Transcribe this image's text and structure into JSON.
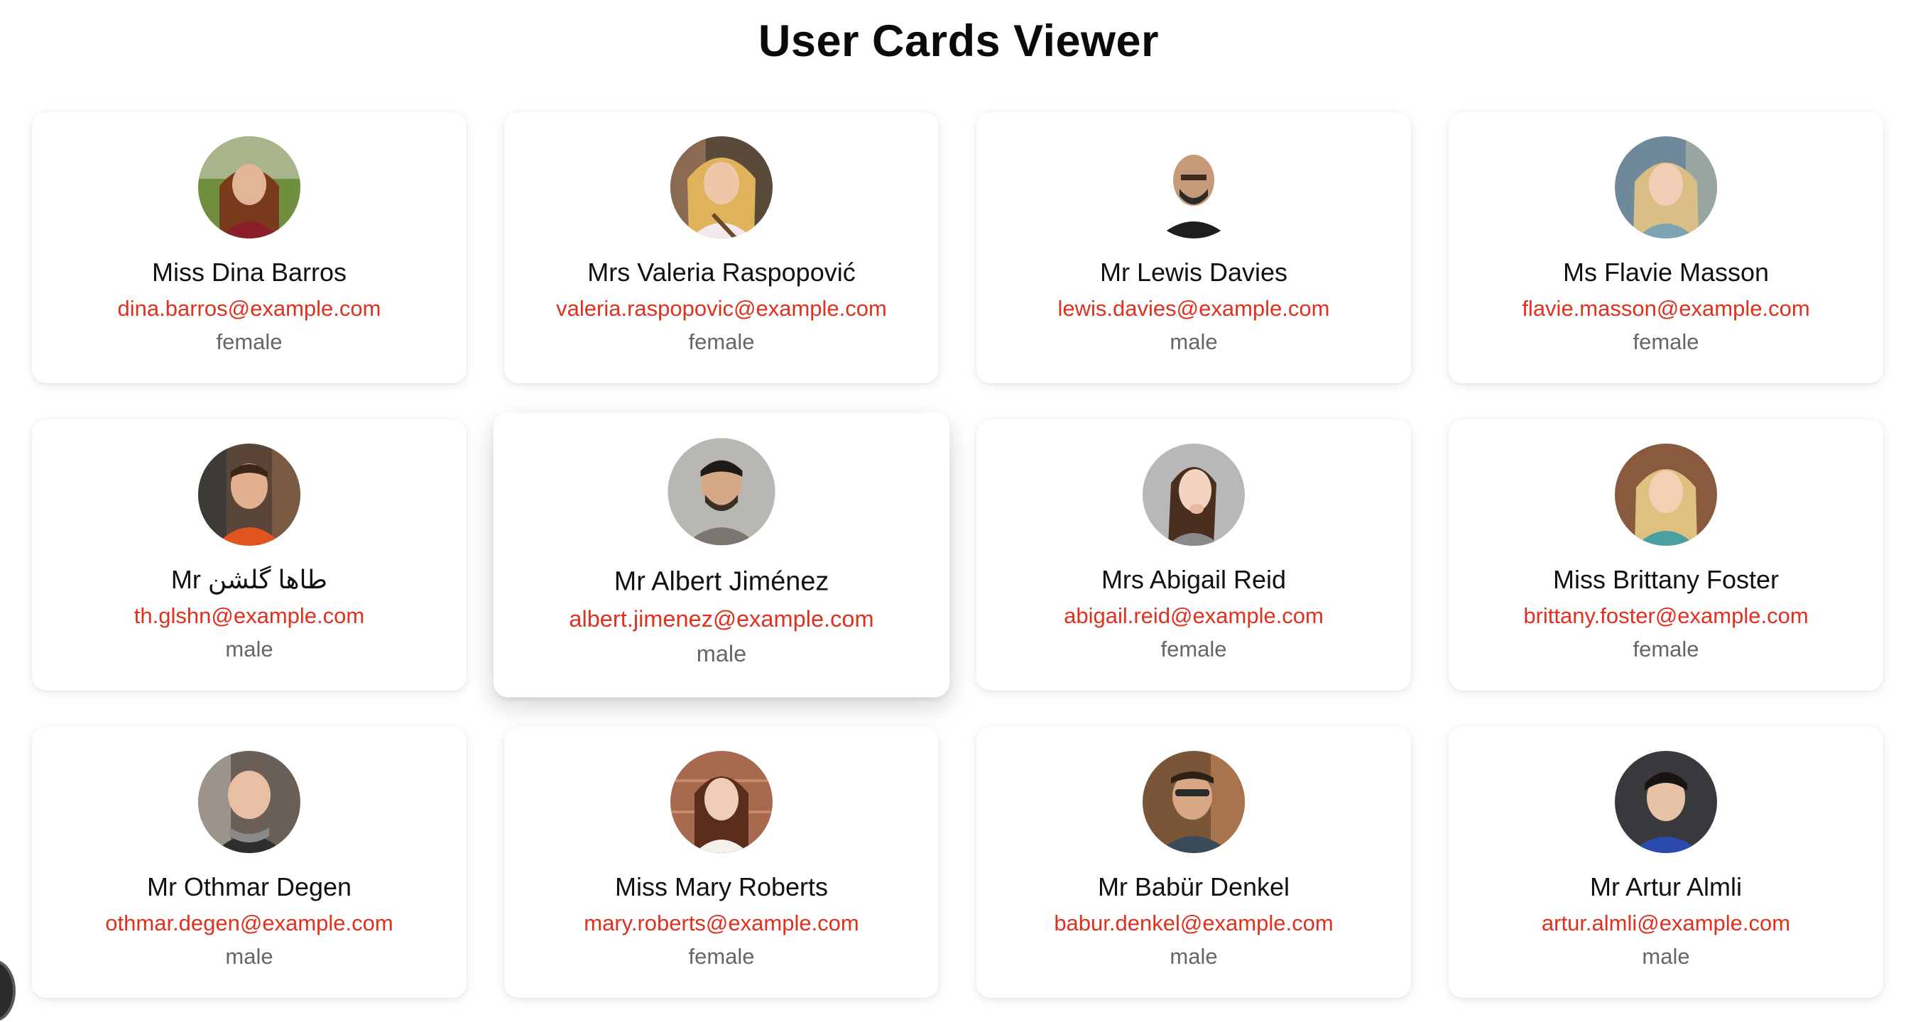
{
  "page": {
    "title": "User Cards Viewer"
  },
  "users": [
    {
      "name": "Miss Dina Barros",
      "email": "dina.barros@example.com",
      "gender": "female"
    },
    {
      "name": "Mrs Valeria Raspopović",
      "email": "valeria.raspopovic@example.com",
      "gender": "female"
    },
    {
      "name": "Mr Lewis Davies",
      "email": "lewis.davies@example.com",
      "gender": "male"
    },
    {
      "name": "Ms Flavie Masson",
      "email": "flavie.masson@example.com",
      "gender": "female"
    },
    {
      "name": "Mr طاها گلشن",
      "email": "th.glshn@example.com",
      "gender": "male"
    },
    {
      "name": "Mr Albert Jiménez",
      "email": "albert.jimenez@example.com",
      "gender": "male"
    },
    {
      "name": "Mrs Abigail Reid",
      "email": "abigail.reid@example.com",
      "gender": "female"
    },
    {
      "name": "Miss Brittany Foster",
      "email": "brittany.foster@example.com",
      "gender": "female"
    },
    {
      "name": "Mr Othmar Degen",
      "email": "othmar.degen@example.com",
      "gender": "male"
    },
    {
      "name": "Miss Mary Roberts",
      "email": "mary.roberts@example.com",
      "gender": "female"
    },
    {
      "name": "Mr Babür Denkel",
      "email": "babur.denkel@example.com",
      "gender": "male"
    },
    {
      "name": "Mr Artur Almli",
      "email": "artur.almli@example.com",
      "gender": "male"
    }
  ],
  "colors": {
    "email": "#e0301e",
    "gender": "#666666",
    "name": "#111111"
  },
  "icons": {
    "avatar": "avatar-icon"
  }
}
